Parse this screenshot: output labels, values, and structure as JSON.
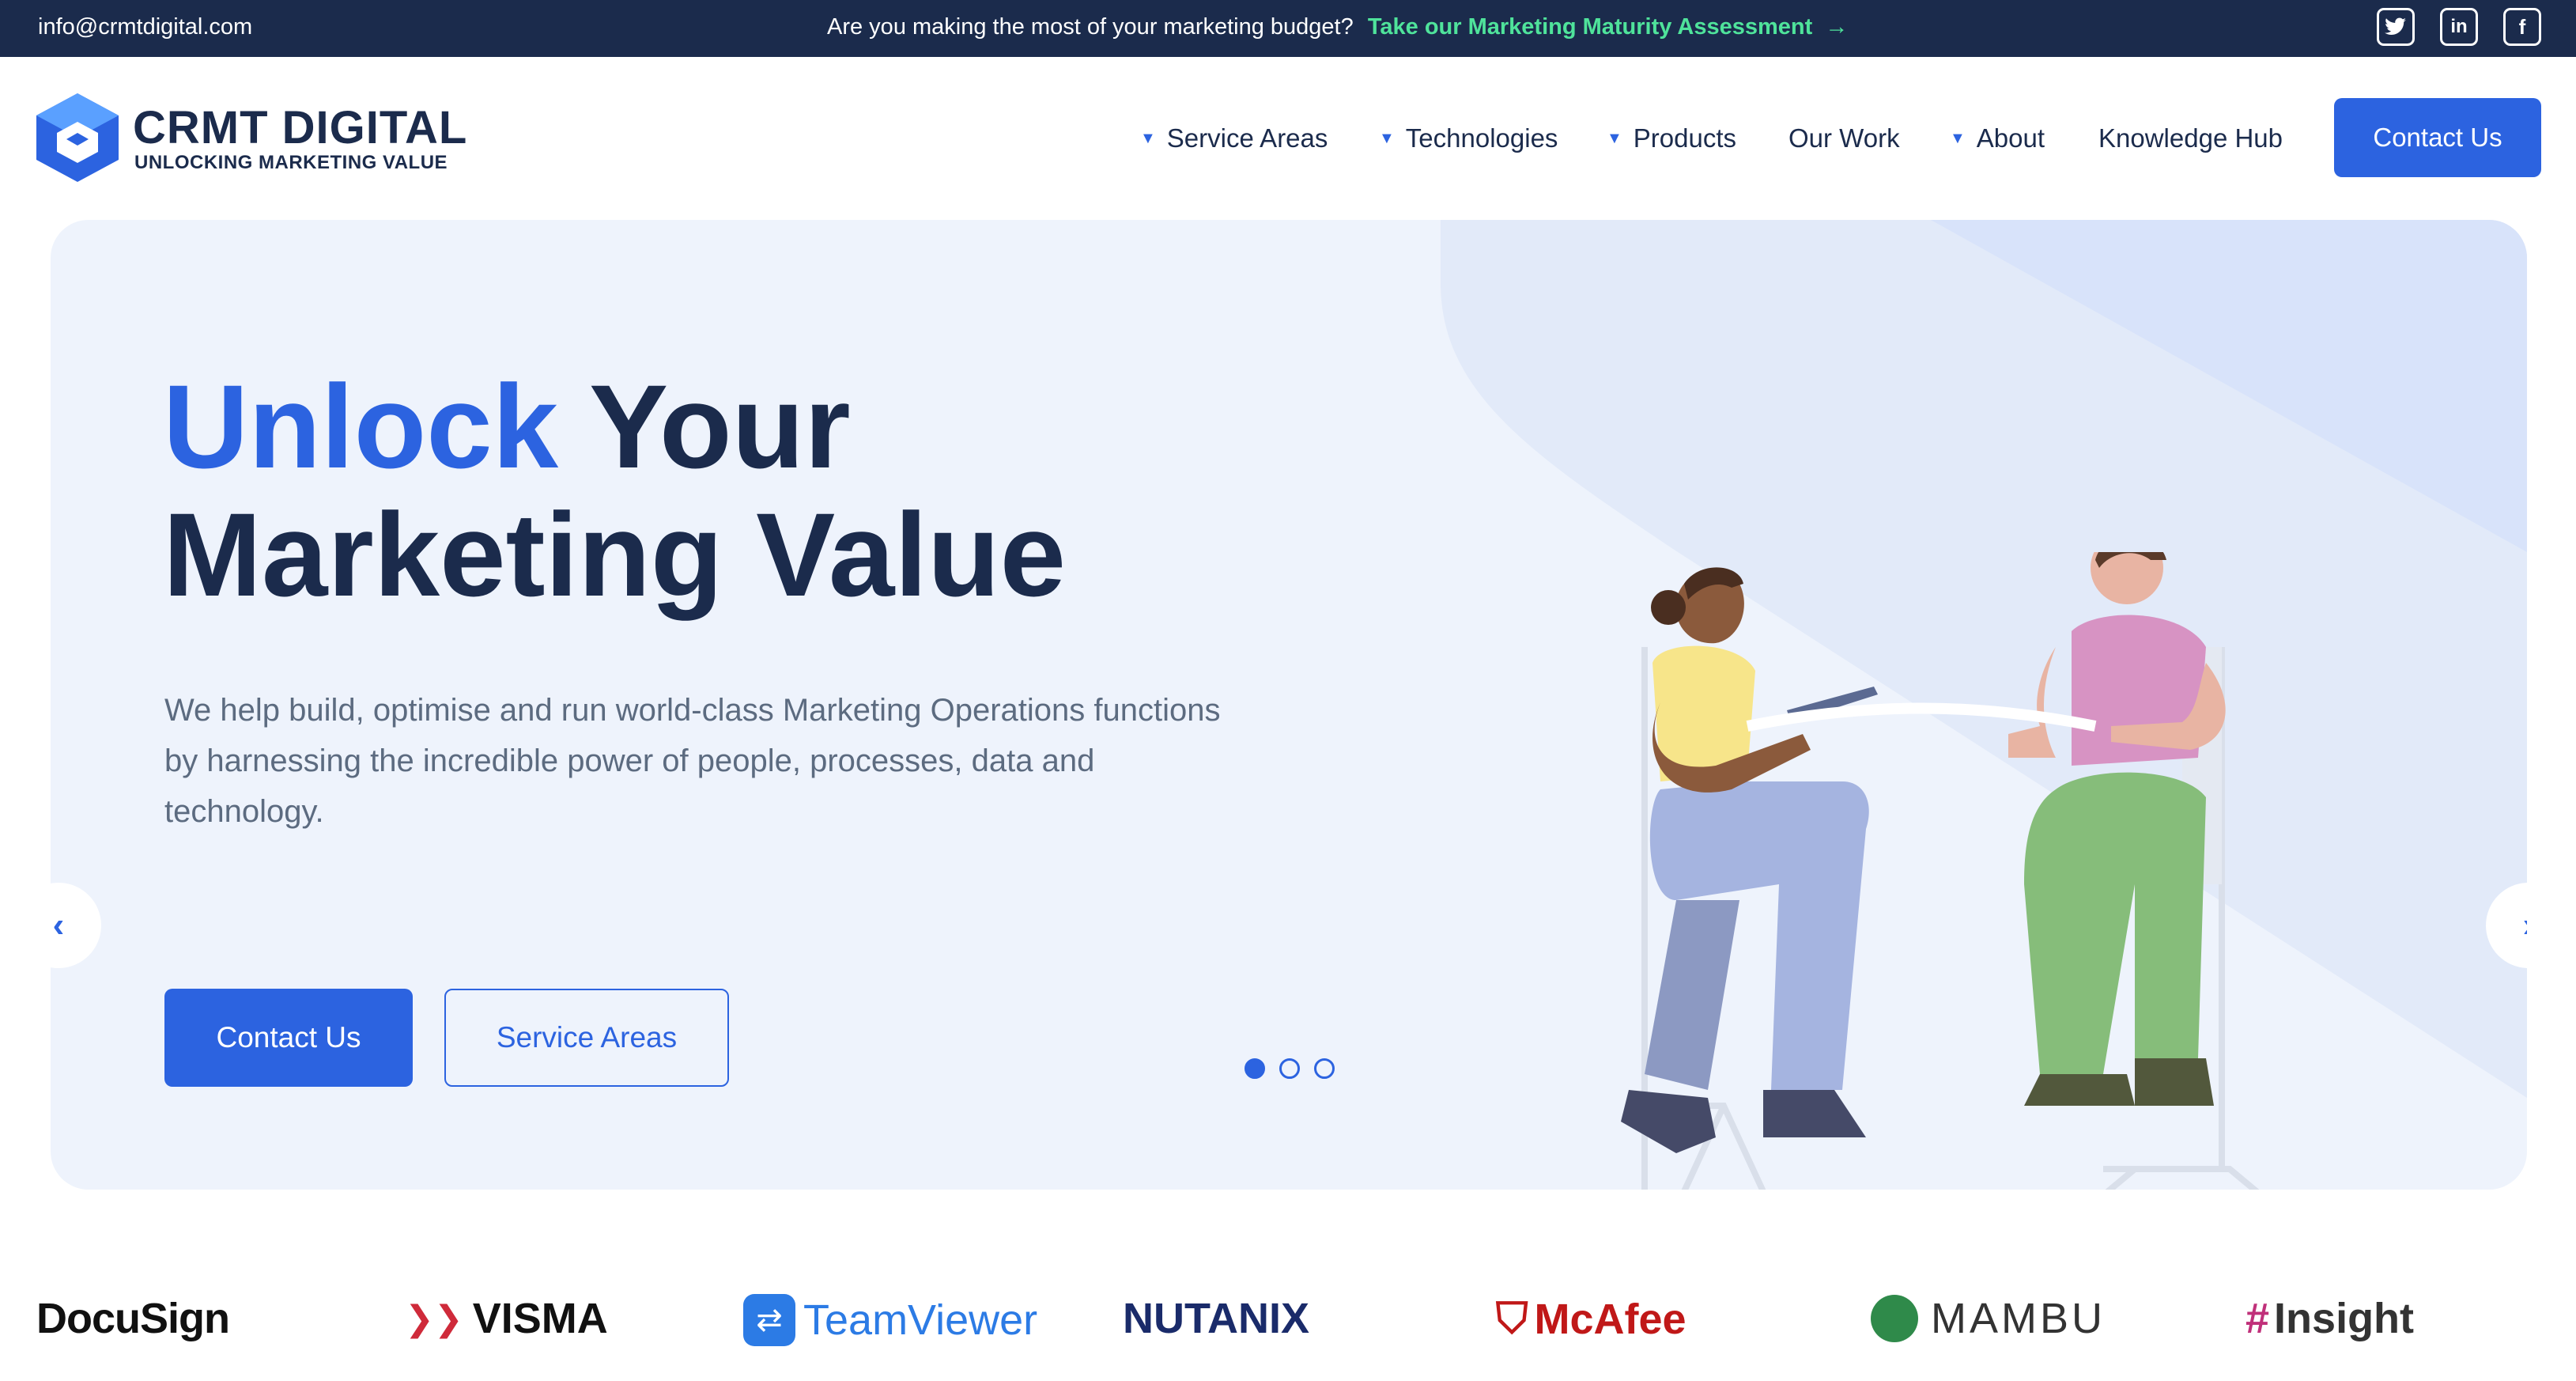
{
  "topbar": {
    "email": "info@crmtdigital.com",
    "promo_text": "Are you making the most of your marketing budget?",
    "promo_link": "Take our Marketing Maturity Assessment",
    "promo_arrow": "→",
    "social": [
      "twitter-icon",
      "linkedin-icon",
      "facebook-icon"
    ]
  },
  "logo": {
    "title": "CRMT DIGITAL",
    "subtitle": "UNLOCKING MARKETING VALUE"
  },
  "nav": {
    "items": [
      {
        "label": "Service Areas",
        "dropdown": true
      },
      {
        "label": "Technologies",
        "dropdown": true
      },
      {
        "label": "Products",
        "dropdown": true
      },
      {
        "label": "Our Work",
        "dropdown": false
      },
      {
        "label": "About",
        "dropdown": true
      },
      {
        "label": "Knowledge Hub",
        "dropdown": false
      }
    ],
    "cta": "Contact Us"
  },
  "hero": {
    "title_accent": "Unlock",
    "title_rest_line1": " Your",
    "title_line2": "Marketing Value",
    "lead": "We help build, optimise and run world-class Marketing Operations functions by harnessing the incredible power of people, processes, data and technology.",
    "primary_button": "Contact Us",
    "secondary_button": "Service Areas",
    "slide_count": 3,
    "active_slide": 1
  },
  "brands": [
    "DocuSign",
    "VISMA",
    "TeamViewer",
    "NUTANIX",
    "McAfee",
    "MAMBU",
    "Insight"
  ],
  "colors": {
    "navy": "#1b2b4c",
    "accent": "#2c63e0",
    "promo": "#4fe39b",
    "hero_bg": "#eef3fc"
  }
}
